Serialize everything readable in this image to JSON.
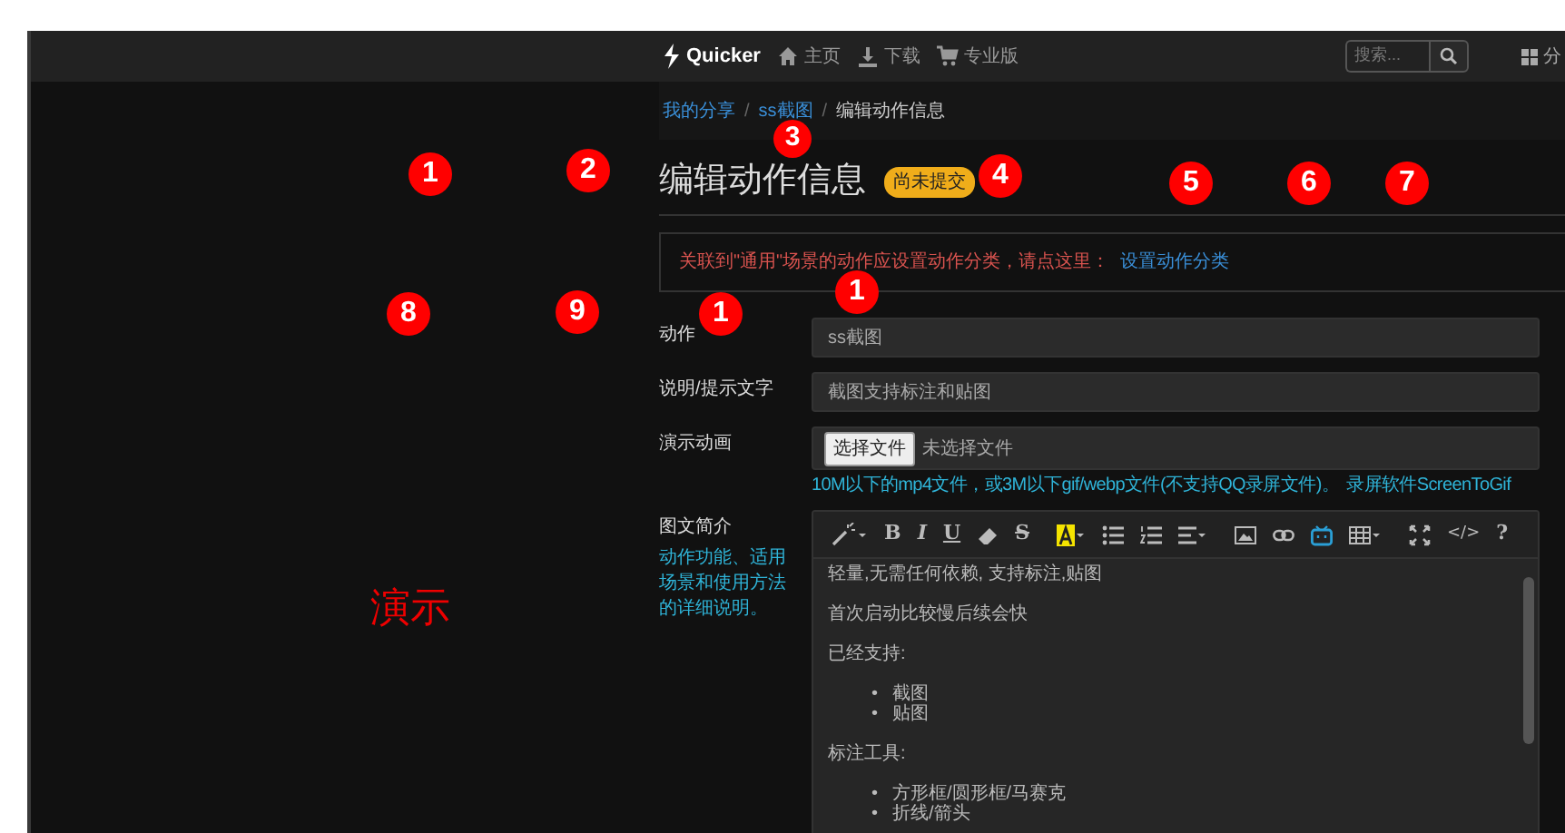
{
  "navbar": {
    "brand": "Quicker",
    "links": [
      {
        "kind": "home",
        "label": "主页"
      },
      {
        "kind": "download",
        "label": "下载"
      },
      {
        "kind": "cart",
        "label": "专业版"
      }
    ],
    "search": {
      "placeholder": "搜索..."
    },
    "share_label": "分"
  },
  "breadcrumb": [
    {
      "label": "我的分享",
      "link": true
    },
    {
      "label": "ss截图",
      "link": true
    },
    {
      "label": "编辑动作信息",
      "link": false
    }
  ],
  "breadcrumb_separators": [
    "/",
    "/"
  ],
  "title": "编辑动作信息",
  "status_badge": "尚未提交",
  "alert": {
    "message": "关联到\"通用\"场景的动作应设置动作分类，请点这里：",
    "link": "设置动作分类"
  },
  "fields": [
    {
      "kind": "text",
      "label": "动作",
      "value": "ss截图"
    },
    {
      "kind": "text",
      "label": "说明/提示文字",
      "value": "截图支持标注和贴图"
    },
    {
      "kind": "file",
      "label": "演示动画",
      "button": "选择文件",
      "file_status": "未选择文件",
      "help": "10M以下的mp4文件，或3M以下gif/webp文件(不支持QQ录屏文件)。",
      "help_link": "录屏软件ScreenToGif"
    }
  ],
  "description": {
    "label": "图文简介",
    "hint": "动作功能、适用场景和使用方法的详细说明。",
    "toolbar": [
      {
        "kind": "wand",
        "caret": true
      },
      {
        "kind": "bold",
        "label": "B"
      },
      {
        "kind": "italic",
        "label": "I"
      },
      {
        "kind": "underline",
        "label": "U"
      },
      {
        "kind": "eraser",
        "caret": false
      },
      {
        "kind": "strike",
        "label": "S"
      },
      {
        "kind": "highlight",
        "caret": true
      },
      {
        "kind": "ul",
        "caret": false
      },
      {
        "kind": "ol",
        "caret": false
      },
      {
        "kind": "align",
        "caret": true
      },
      {
        "kind": "image",
        "caret": false
      },
      {
        "kind": "link",
        "caret": false
      },
      {
        "kind": "tv",
        "caret": false
      },
      {
        "kind": "table",
        "caret": true
      },
      {
        "kind": "fullscreen",
        "caret": false
      },
      {
        "kind": "code",
        "label": "</>"
      },
      {
        "kind": "help",
        "label": "?"
      }
    ],
    "content": [
      {
        "kind": "p",
        "text": "轻量,无需任何依赖, 支持标注,贴图"
      },
      {
        "kind": "p",
        "text": "首次启动比较慢后续会快"
      },
      {
        "kind": "p",
        "text": "已经支持:"
      },
      {
        "kind": "ul",
        "marker": "•",
        "items": [
          "截图",
          "贴图"
        ]
      },
      {
        "kind": "p",
        "text": "标注工具:"
      },
      {
        "kind": "ul",
        "marker": "•",
        "items": [
          "方形框/圆形框/马赛克",
          "折线/箭头"
        ]
      }
    ]
  },
  "annotations": {
    "markers": [
      "1",
      "2",
      "3",
      "4",
      "5",
      "6",
      "7",
      "8",
      "9",
      "1",
      "1"
    ],
    "caption": "演示"
  }
}
